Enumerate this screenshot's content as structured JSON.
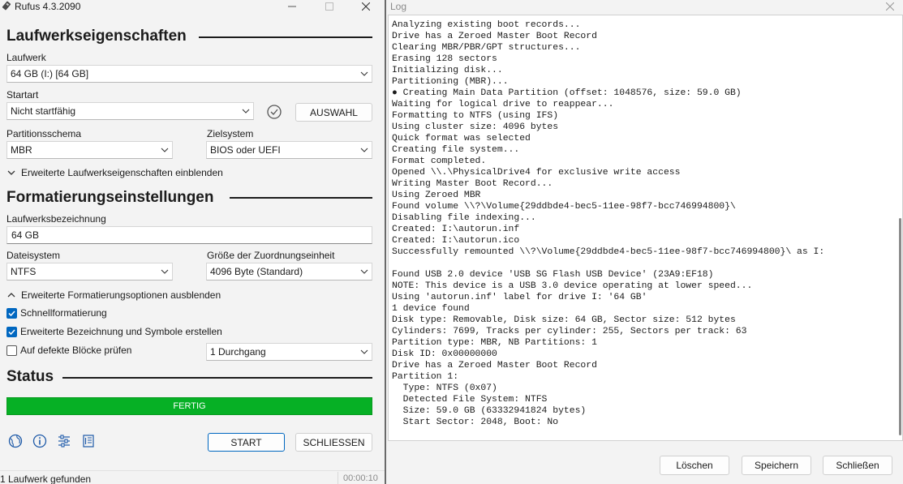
{
  "rufus": {
    "title": "Rufus 4.3.2090",
    "sections": {
      "drive_props": "Laufwerkseigenschaften",
      "format_opts": "Formatierungseinstellungen",
      "status": "Status"
    },
    "drive": {
      "label": "Laufwerk",
      "value": "64 GB (I:) [64 GB]"
    },
    "boot": {
      "label": "Startart",
      "value": "Nicht startfähig",
      "select_button": "AUSWAHL"
    },
    "partition_scheme": {
      "label": "Partitionsschema",
      "value": "MBR"
    },
    "target_system": {
      "label": "Zielsystem",
      "value": "BIOS oder UEFI"
    },
    "advanced_drive_toggle": "Erweiterte Laufwerkseigenschaften einblenden",
    "volume_label": {
      "label": "Laufwerksbezeichnung",
      "value": "64 GB"
    },
    "filesystem": {
      "label": "Dateisystem",
      "value": "NTFS"
    },
    "cluster_size": {
      "label": "Größe der Zuordnungseinheit",
      "value": "4096 Byte (Standard)"
    },
    "advanced_format_toggle": "Erweiterte Formatierungsoptionen ausblenden",
    "quick_format": {
      "label": "Schnellformatierung",
      "checked": true
    },
    "extended_label": {
      "label": "Erweiterte Bezeichnung und Symbole erstellen",
      "checked": true
    },
    "bad_blocks": {
      "label": "Auf defekte Blöcke prüfen",
      "checked": false,
      "passes": "1 Durchgang"
    },
    "progress": {
      "text": "FERTIG",
      "fraction": 1.0,
      "color": "#06b025"
    },
    "buttons": {
      "start": "START",
      "close": "SCHLIESSEN"
    },
    "toolbar_icons": [
      "globe-icon",
      "info-icon",
      "settings-sliders-icon",
      "log-icon"
    ],
    "statusbar": {
      "text": "1 Laufwerk gefunden",
      "time": "00:00:10"
    }
  },
  "log": {
    "title": "Log",
    "lines": [
      "Analyzing existing boot records...",
      "Drive has a Zeroed Master Boot Record",
      "Clearing MBR/PBR/GPT structures...",
      "Erasing 128 sectors",
      "Initializing disk...",
      "Partitioning (MBR)...",
      "● Creating Main Data Partition (offset: 1048576, size: 59.0 GB)",
      "Waiting for logical drive to reappear...",
      "Formatting to NTFS (using IFS)",
      "Using cluster size: 4096 bytes",
      "Quick format was selected",
      "Creating file system...",
      "Format completed.",
      "Opened \\\\.\\PhysicalDrive4 for exclusive write access",
      "Writing Master Boot Record...",
      "Using Zeroed MBR",
      "Found volume \\\\?\\Volume{29ddbde4-bec5-11ee-98f7-bcc746994800}\\",
      "Disabling file indexing...",
      "Created: I:\\autorun.inf",
      "Created: I:\\autorun.ico",
      "Successfully remounted \\\\?\\Volume{29ddbde4-bec5-11ee-98f7-bcc746994800}\\ as I:",
      "",
      "Found USB 2.0 device 'USB SG Flash USB Device' (23A9:EF18)",
      "NOTE: This device is a USB 3.0 device operating at lower speed...",
      "Using 'autorun.inf' label for drive I: '64 GB'",
      "1 device found",
      "Disk type: Removable, Disk size: 64 GB, Sector size: 512 bytes",
      "Cylinders: 7699, Tracks per cylinder: 255, Sectors per track: 63",
      "Partition type: MBR, NB Partitions: 1",
      "Disk ID: 0x00000000",
      "Drive has a Zeroed Master Boot Record",
      "Partition 1:",
      "  Type: NTFS (0x07)",
      "  Detected File System: NTFS",
      "  Size: 59.0 GB (63332941824 bytes)",
      "  Start Sector: 2048, Boot: No"
    ],
    "buttons": {
      "clear": "Löschen",
      "save": "Speichern",
      "close": "Schließen"
    }
  }
}
